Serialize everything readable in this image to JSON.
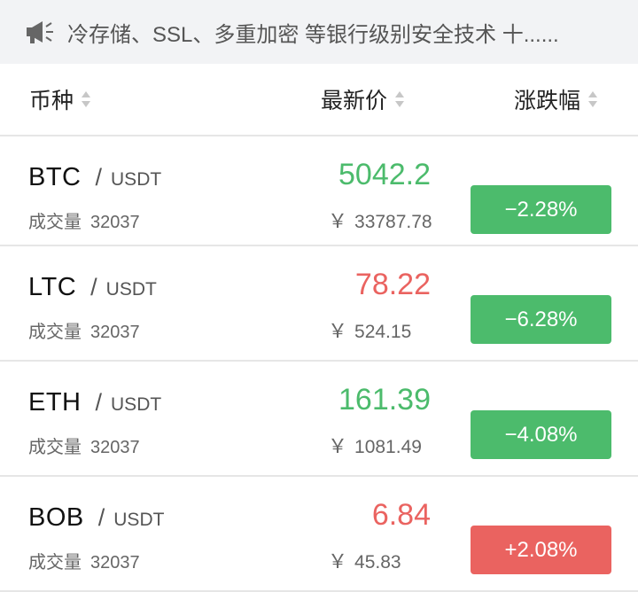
{
  "notice": {
    "icon": "megaphone-icon",
    "text": "冷存储、SSL、多重加密 等银行级别安全技术 十......"
  },
  "header": {
    "col_coin": "币种",
    "col_price": "最新价",
    "col_change": "涨跌幅"
  },
  "labels": {
    "volume": "成交量",
    "yen": "￥"
  },
  "colors": {
    "up": "#4cbb6c",
    "down": "#ea6360",
    "notice_bg": "#f2f3f5"
  },
  "rows": [
    {
      "base": "BTC",
      "quote": "USDT",
      "volume": "32037",
      "price": "5042.2",
      "price_color": "green",
      "cny": "33787.78",
      "change": "−2.28%",
      "change_color": "green"
    },
    {
      "base": "LTC",
      "quote": "USDT",
      "volume": "32037",
      "price": "78.22",
      "price_color": "red",
      "cny": "524.15",
      "change": "−6.28%",
      "change_color": "green"
    },
    {
      "base": "ETH",
      "quote": "USDT",
      "volume": "32037",
      "price": "161.39",
      "price_color": "green",
      "cny": "1081.49",
      "change": "−4.08%",
      "change_color": "green"
    },
    {
      "base": "BOB",
      "quote": "USDT",
      "volume": "32037",
      "price": "6.84",
      "price_color": "red",
      "cny": "45.83",
      "change": "+2.08%",
      "change_color": "red"
    }
  ]
}
